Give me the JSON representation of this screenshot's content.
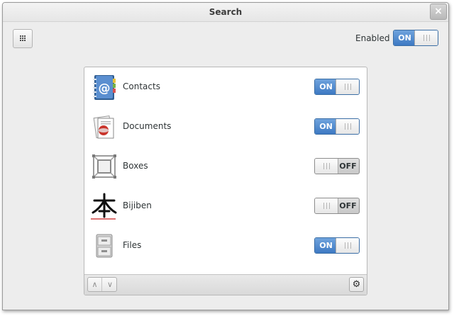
{
  "window": {
    "title": "Search",
    "close_glyph": "×"
  },
  "header": {
    "grid_icon": "view-grid-icon",
    "enabled_label": "Enabled",
    "enabled_switch": {
      "state": "ON",
      "on": true
    }
  },
  "apps": [
    {
      "name": "Contacts",
      "icon": "contacts-icon",
      "switch": "ON",
      "on": true
    },
    {
      "name": "Documents",
      "icon": "documents-icon",
      "switch": "ON",
      "on": true
    },
    {
      "name": "Boxes",
      "icon": "boxes-icon",
      "switch": "OFF",
      "on": false
    },
    {
      "name": "Bijiben",
      "icon": "bijiben-icon",
      "switch": "OFF",
      "on": false
    },
    {
      "name": "Files",
      "icon": "files-icon",
      "switch": "ON",
      "on": true
    }
  ],
  "toolbar": {
    "up_glyph": "∧",
    "down_glyph": "∨",
    "gear_glyph": "⚙"
  },
  "colors": {
    "accent": "#3d79c3",
    "switch_on_top": "#6fa3dd",
    "background": "#ededed"
  }
}
